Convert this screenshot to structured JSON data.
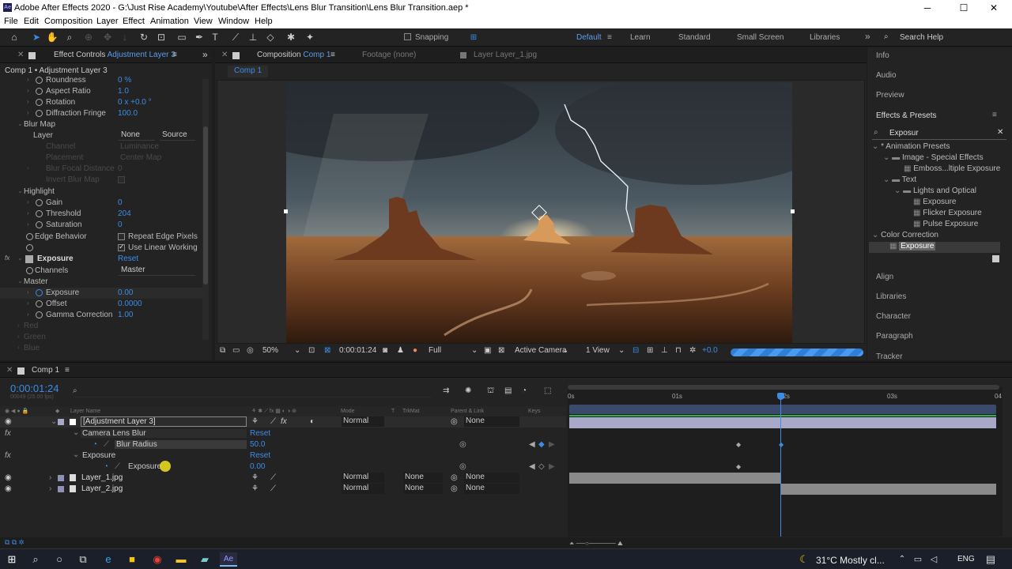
{
  "window": {
    "title": "Adobe After Effects 2020 - G:\\Just Rise Academy\\Youtube\\After Effects\\Lens Blur Transition\\Lens Blur Transition.aep *",
    "app_icon": "Ae",
    "minimize": "─",
    "maximize": "☐",
    "close": "✕"
  },
  "menu": [
    "File",
    "Edit",
    "Composition",
    "Layer",
    "Effect",
    "Animation",
    "View",
    "Window",
    "Help"
  ],
  "toolbar": {
    "snapping": "Snapping",
    "workspaces": [
      "Default",
      "Learn",
      "Standard",
      "Small Screen",
      "Libraries"
    ],
    "more": "»",
    "search_help": "Search Help"
  },
  "effect_controls": {
    "tab_prefix": "Effect Controls ",
    "tab_layer": "Adjustment Layer 3",
    "breadcrumb": "Comp 1 • Adjustment Layer 3",
    "rows": {
      "roundness": "Roundness",
      "roundness_val": "0 %",
      "aspect": "Aspect Ratio",
      "aspect_val": "1.0",
      "rotation": "Rotation",
      "rotation_val": "0 x +0.0 °",
      "fringe": "Diffraction Fringe",
      "fringe_val": "100.0",
      "blurmap": "Blur Map",
      "layer": "Layer",
      "layer_val": "None",
      "source_val": "Source",
      "channel": "Channel",
      "channel_val": "Luminance",
      "placement": "Placement",
      "placement_val": "Center Map",
      "focal": "Blur Focal Distance",
      "focal_val": "0",
      "invert": "Invert Blur Map",
      "highlight": "Highlight",
      "gain": "Gain",
      "gain_val": "0",
      "threshold": "Threshold",
      "threshold_val": "204",
      "saturation": "Saturation",
      "saturation_val": "0",
      "edge": "Edge Behavior",
      "repeat": "Repeat Edge Pixels",
      "linear": "Use Linear Working",
      "exposure_fx": "Exposure",
      "reset": "Reset",
      "channels": "Channels",
      "channels_val": "Master",
      "master": "Master",
      "exposure": "Exposure",
      "exposure_val": "0.00",
      "offset": "Offset",
      "offset_val": "0.0000",
      "gamma": "Gamma Correction",
      "gamma_val": "1.00",
      "red": "Red",
      "green": "Green",
      "blue": "Blue"
    }
  },
  "composition": {
    "tab_prefix": "Composition ",
    "tab_name": "Comp 1",
    "footage_tab": "Footage  (none)",
    "layer_tab": "Layer  Layer_1.jpg",
    "breadcrumb": "Comp 1",
    "zoom": "50%",
    "timecode": "0:00:01:24",
    "resolution": "Full",
    "camera": "Active Camera",
    "views": "1 View",
    "exposure": "+0.0"
  },
  "right_panel": {
    "info": "Info",
    "audio": "Audio",
    "preview": "Preview",
    "effects_title": "Effects & Presets",
    "search": "Exposur",
    "tree": [
      "* Animation Presets",
      "Image - Special Effects",
      "Emboss...ltiple Exposure",
      "Text",
      "Lights and Optical",
      "Exposure",
      "Flicker Exposure",
      "Pulse Exposure",
      "Color Correction",
      "Exposure"
    ],
    "align": "Align",
    "libraries": "Libraries",
    "character": "Character",
    "paragraph": "Paragraph",
    "tracker": "Tracker"
  },
  "timeline": {
    "tab": "Comp 1",
    "timecode": "0:00:01:24",
    "fps": "00049 (25.00 fps)",
    "search_placeholder": "",
    "cols": {
      "layer_name": "Layer Name",
      "mode": "Mode",
      "t": "T",
      "trkmat": "TrkMat",
      "parent": "Parent & Link",
      "keys": "Keys"
    },
    "ruler": [
      "0s",
      "01s",
      "02s",
      "03s",
      "04"
    ],
    "layers": [
      {
        "num": "1",
        "name": "[Adjustment Layer 3]",
        "mode": "Normal",
        "trkmat": "",
        "parent": "None"
      },
      {
        "num": "2",
        "name": "Layer_1.jpg",
        "mode": "Normal",
        "trkmat": "None",
        "parent": "None"
      },
      {
        "num": "3",
        "name": "Layer_2.jpg",
        "mode": "Normal",
        "trkmat": "None",
        "parent": "None"
      }
    ],
    "fx1": "Camera Lens Blur",
    "reset": "Reset",
    "blur_radius": "Blur Radius",
    "blur_radius_val": "50.0",
    "fx2": "Exposure",
    "exposure": "Exposure",
    "exposure_val": "0.00"
  },
  "taskbar": {
    "weather": "31°C  Mostly cl...",
    "lang": "ENG"
  },
  "colors": {
    "accent": "#3c8ce6",
    "panel": "#232323",
    "label_adjust": "#a8a8c8",
    "label_layer": "#8f8fb8"
  }
}
